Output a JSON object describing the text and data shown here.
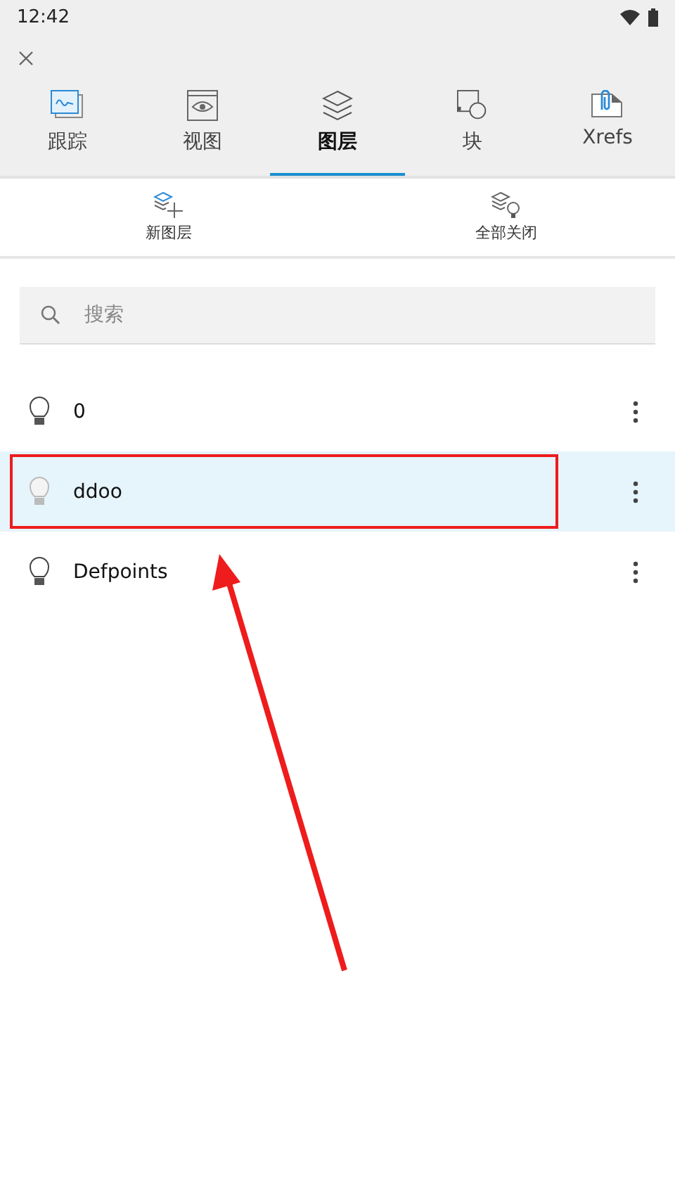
{
  "status_bar": {
    "time": "12:42"
  },
  "tabs": [
    {
      "label": "跟踪",
      "selected": false
    },
    {
      "label": "视图",
      "selected": false
    },
    {
      "label": "图层",
      "selected": true
    },
    {
      "label": "块",
      "selected": false
    },
    {
      "label": "Xrefs",
      "selected": false
    }
  ],
  "actions": [
    {
      "label": "新图层"
    },
    {
      "label": "全部关闭"
    }
  ],
  "search": {
    "placeholder": "搜索"
  },
  "layers": [
    {
      "name": "0",
      "on": true,
      "selected": false,
      "annotated": false
    },
    {
      "name": "ddoo",
      "on": false,
      "selected": true,
      "annotated": true
    },
    {
      "name": "Defpoints",
      "on": true,
      "selected": false,
      "annotated": false
    }
  ],
  "annotation": {
    "arrow": true
  }
}
